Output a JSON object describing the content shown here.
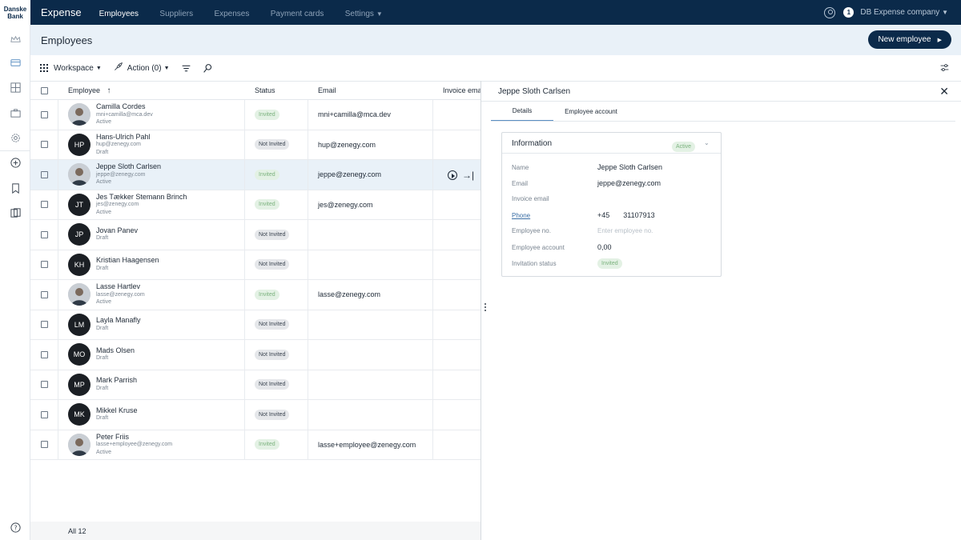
{
  "brand": {
    "line1": "Danske",
    "line2": "Bank"
  },
  "app_title": "Expense",
  "nav": [
    {
      "label": "Employees",
      "active": true
    },
    {
      "label": "Suppliers",
      "active": false
    },
    {
      "label": "Expenses",
      "active": false
    },
    {
      "label": "Payment cards",
      "active": false
    },
    {
      "label": "Settings",
      "active": false
    }
  ],
  "topright": {
    "notifications": "1",
    "company": "DB Expense company"
  },
  "page_title": "Employees",
  "new_button": "New employee",
  "toolbar": {
    "workspace": "Workspace",
    "action": "Action (0)"
  },
  "table": {
    "headers": {
      "employee": "Employee",
      "status": "Status",
      "email": "Email",
      "invoice_email": "Invoice email"
    },
    "rows": [
      {
        "name": "Camilla Cordes",
        "sub": "mni+camilla@mca.dev",
        "state": "Active",
        "initials": "",
        "photo": true,
        "status": "Invited",
        "email": "mni+camilla@mca.dev"
      },
      {
        "name": "Hans-Ulrich Pahl",
        "sub": "hup@zenegy.com",
        "state": "Draft",
        "initials": "HP",
        "photo": false,
        "status": "Not Invited",
        "email": "hup@zenegy.com"
      },
      {
        "name": "Jeppe Sloth Carlsen",
        "sub": "jeppe@zenegy.com",
        "state": "Active",
        "initials": "",
        "photo": true,
        "status": "Invited",
        "email": "jeppe@zenegy.com"
      },
      {
        "name": "Jes Tækker Stemann Brinch",
        "sub": "jes@zenegy.com",
        "state": "Active",
        "initials": "JT",
        "photo": false,
        "status": "Invited",
        "email": "jes@zenegy.com"
      },
      {
        "name": "Jovan Panev",
        "sub": "",
        "state": "Draft",
        "initials": "JP",
        "photo": false,
        "status": "Not Invited",
        "email": ""
      },
      {
        "name": "Kristian Haagensen",
        "sub": "",
        "state": "Draft",
        "initials": "KH",
        "photo": false,
        "status": "Not Invited",
        "email": ""
      },
      {
        "name": "Lasse Hartlev",
        "sub": "lasse@zenegy.com",
        "state": "Active",
        "initials": "",
        "photo": true,
        "status": "Invited",
        "email": "lasse@zenegy.com"
      },
      {
        "name": "Layla Manafly",
        "sub": "",
        "state": "Draft",
        "initials": "LM",
        "photo": false,
        "status": "Not Invited",
        "email": ""
      },
      {
        "name": "Mads Olsen",
        "sub": "",
        "state": "Draft",
        "initials": "MO",
        "photo": false,
        "status": "Not Invited",
        "email": ""
      },
      {
        "name": "Mark Parrish",
        "sub": "",
        "state": "Draft",
        "initials": "MP",
        "photo": false,
        "status": "Not Invited",
        "email": ""
      },
      {
        "name": "Mikkel Kruse",
        "sub": "",
        "state": "Draft",
        "initials": "MK",
        "photo": false,
        "status": "Not Invited",
        "email": ""
      },
      {
        "name": "Peter Friis",
        "sub": "lasse+employee@zenegy.com",
        "state": "Active",
        "initials": "",
        "photo": true,
        "status": "Invited",
        "email": "lasse+employee@zenegy.com"
      }
    ],
    "footer": "All 12"
  },
  "panel": {
    "title": "Jeppe Sloth Carlsen",
    "tabs": {
      "details": "Details",
      "account": "Employee account"
    },
    "info": {
      "title": "Information",
      "badge": "Active",
      "name_label": "Name",
      "name_value": "Jeppe Sloth Carlsen",
      "email_label": "Email",
      "email_value": "jeppe@zenegy.com",
      "invoice_label": "Invoice email",
      "phone_label": "Phone",
      "phone_prefix": "+45",
      "phone_value": "31107913",
      "empno_label": "Employee no.",
      "empno_placeholder": "Enter employee no.",
      "account_label": "Employee account",
      "account_value": "0,00",
      "invitation_label": "Invitation status",
      "invitation_value": "Invited"
    }
  }
}
